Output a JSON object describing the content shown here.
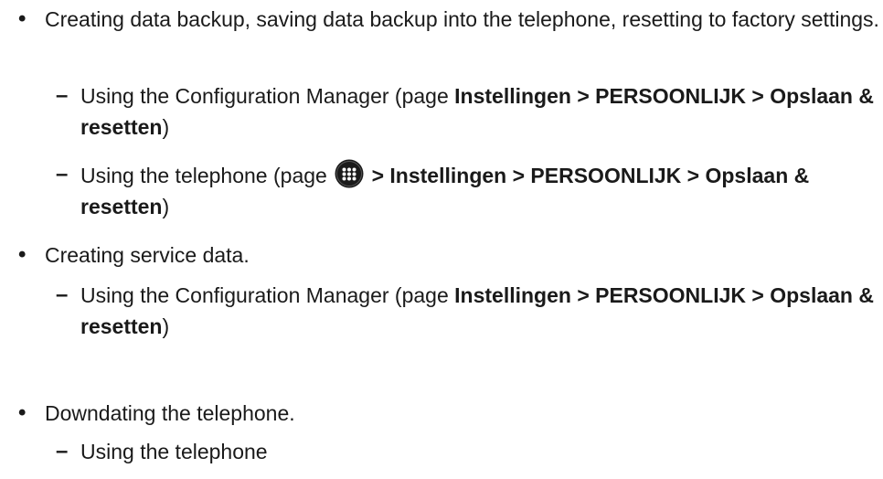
{
  "list": {
    "item1": {
      "bullet": "•",
      "text": "Creating data backup, saving data backup into the telephone, resetting to factory settings.",
      "sub1": {
        "dash": "–",
        "pre": "Using the Configuration Manager (page ",
        "bold": "Instellingen > PERSOONLIJK > Opslaan & resetten",
        "post": ")"
      },
      "sub2": {
        "dash": "–",
        "pre": "Using the telephone (page ",
        "icon": "apps-grid-icon",
        "bold": " > Instellingen > PERSOONLIJK > Opslaan & resetten",
        "post": ")"
      }
    },
    "item2": {
      "bullet": "•",
      "text": "Creating service data.",
      "sub1": {
        "dash": "–",
        "pre": "Using the Configuration Manager (page ",
        "bold": "Instellingen > PERSOONLIJK > Opslaan & resetten",
        "post": ")"
      }
    },
    "item3": {
      "bullet": "•",
      "text": "Downdating the telephone.",
      "sub1": {
        "dash": "–",
        "text": "Using the telephone"
      }
    }
  },
  "colors": {
    "text": "#1a1a1a",
    "icon_bg": "#1a1a1a",
    "icon_dots": "#ffffff"
  }
}
